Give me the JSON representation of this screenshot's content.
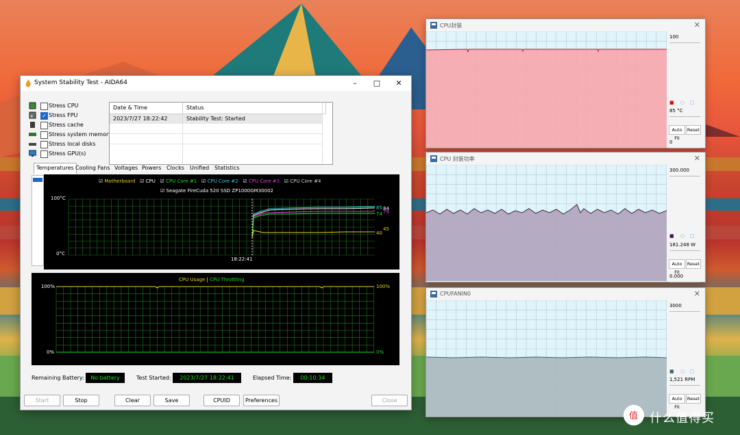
{
  "main_window": {
    "title": "System Stability Test - AIDA64",
    "stress_options": [
      {
        "label": "Stress CPU",
        "checked": false
      },
      {
        "label": "Stress FPU",
        "checked": true
      },
      {
        "label": "Stress cache",
        "checked": false
      },
      {
        "label": "Stress system memory",
        "checked": false
      },
      {
        "label": "Stress local disks",
        "checked": false
      },
      {
        "label": "Stress GPU(s)",
        "checked": false
      }
    ],
    "log": {
      "columns": [
        "Date & Time",
        "Status"
      ],
      "rows": [
        [
          "2023/7/27 18:22:42",
          "Stability Test: Started"
        ]
      ]
    },
    "tabs": [
      "Temperatures",
      "Cooling Fans",
      "Voltages",
      "Powers",
      "Clocks",
      "Unified",
      "Statistics"
    ],
    "active_tab": "Temperatures",
    "temp_graph": {
      "legend": [
        {
          "label": "Motherboard",
          "color": "#e6d21e"
        },
        {
          "label": "CPU",
          "color": "#ffffff"
        },
        {
          "label": "CPU Core #1",
          "color": "#19e01c"
        },
        {
          "label": "CPU Core #2",
          "color": "#3cc8e8"
        },
        {
          "label": "CPU Core #3",
          "color": "#e040e0"
        },
        {
          "label": "CPU Core #4",
          "color": "#d0d0d0"
        }
      ],
      "legend2": "Seagate FireCuda 520 SSD ZP1000GM30002",
      "y_top": "100°C",
      "y_bottom": "0°C",
      "x_label": "18:22:41",
      "values": [
        "85",
        "84",
        "79",
        "74",
        "45",
        "40"
      ]
    },
    "usage_graph": {
      "title_a": "CPU Usage",
      "sep": "|",
      "title_b": "CPU Throttling",
      "left_top": "100%",
      "left_bottom": "0%",
      "right_top": "100%",
      "right_bottom": "0%"
    },
    "status": {
      "battery_label": "Remaining Battery:",
      "battery_value": "No battery",
      "started_label": "Test Started:",
      "started_value": "2023/7/27 18:22:41",
      "elapsed_label": "Elapsed Time:",
      "elapsed_value": "00:10:34"
    },
    "buttons": [
      "Start",
      "Stop",
      "Clear",
      "Save",
      "CPUID",
      "Preferences",
      "Close"
    ]
  },
  "side_windows": [
    {
      "title": "CPU封装",
      "max": "100",
      "reading": "85 °C",
      "min": "0",
      "fill": "#f6a6ac",
      "line": "#c0143c",
      "level": 0.85
    },
    {
      "title": "CPU 封装功率",
      "max": "300.000",
      "reading": "181.248 W",
      "min": "0.000",
      "fill": "#b0a4bc",
      "line": "#3a2a4a",
      "level": 0.6
    },
    {
      "title": "CPUFANIN0",
      "max": "3000",
      "reading": "1,521 RPM",
      "min": "",
      "fill": "#a8b8bc",
      "line": "#4a6070",
      "level": 0.51
    }
  ],
  "side_buttons": [
    "Auto Fit",
    "Reset"
  ],
  "watermark": "什么值得买"
}
